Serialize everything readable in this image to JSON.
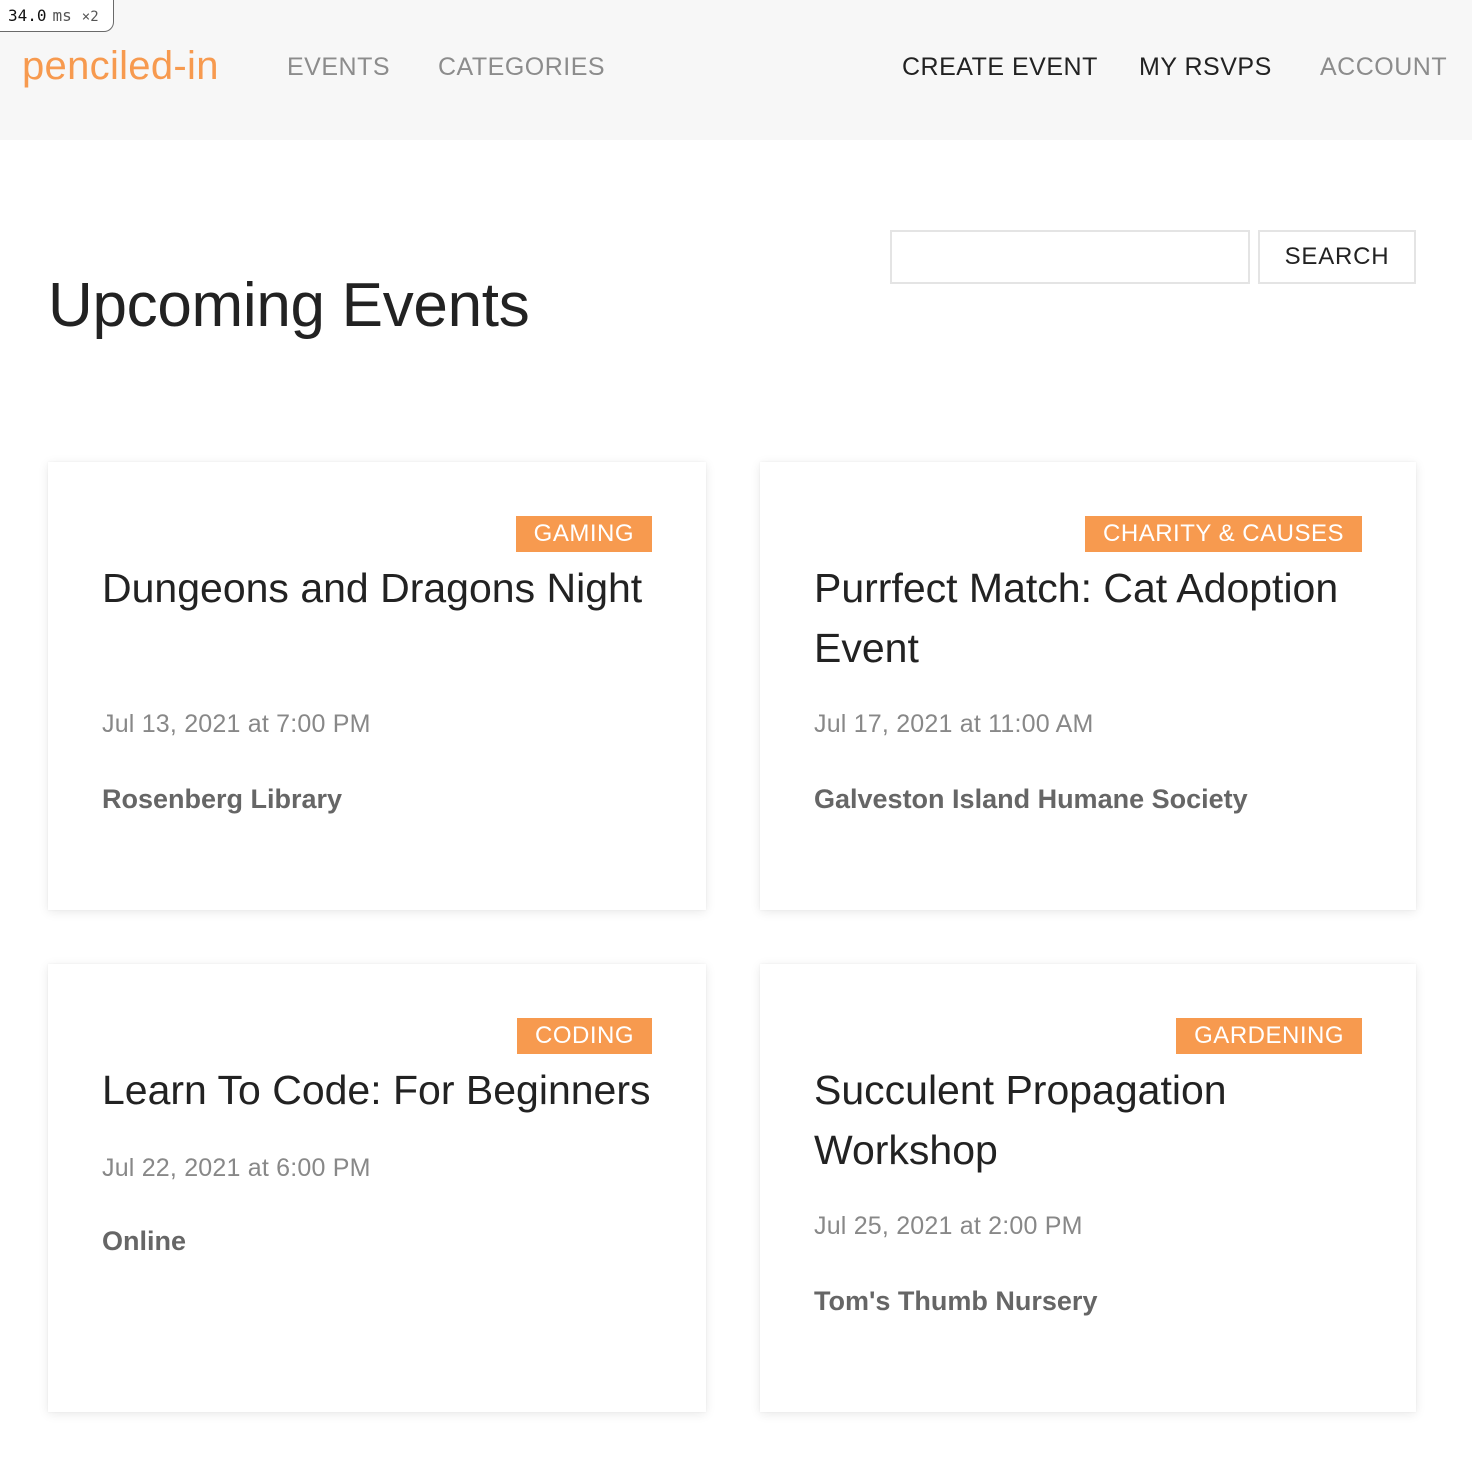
{
  "perf_badge": {
    "value": "34.0",
    "unit": "ms",
    "multiplier": "×2"
  },
  "nav": {
    "logo": "penciled-in",
    "left_links": [
      "EVENTS",
      "CATEGORIES"
    ],
    "right_links": [
      "CREATE EVENT",
      "MY RSVPS",
      "ACCOUNT"
    ]
  },
  "page": {
    "title": "Upcoming Events"
  },
  "search": {
    "placeholder": "",
    "value": "",
    "button_label": "SEARCH"
  },
  "colors": {
    "accent": "#f79a4f",
    "nav_bg": "#f7f7f7"
  },
  "events": [
    {
      "category": "GAMING",
      "title": "Dungeons and Dragons Night",
      "date": "Jul 13, 2021 at 7:00 PM",
      "venue": "Rosenberg Library"
    },
    {
      "category": "CHARITY & CAUSES",
      "title": "Purrfect Match: Cat Adoption Event",
      "date": "Jul 17, 2021 at 11:00 AM",
      "venue": "Galveston Island Humane Society"
    },
    {
      "category": "CODING",
      "title": "Learn To Code: For Beginners",
      "date": "Jul 22, 2021 at 6:00 PM",
      "venue": "Online"
    },
    {
      "category": "GARDENING",
      "title": "Succulent Propagation Workshop",
      "date": "Jul 25, 2021 at 2:00 PM",
      "venue": "Tom's Thumb Nursery"
    }
  ]
}
